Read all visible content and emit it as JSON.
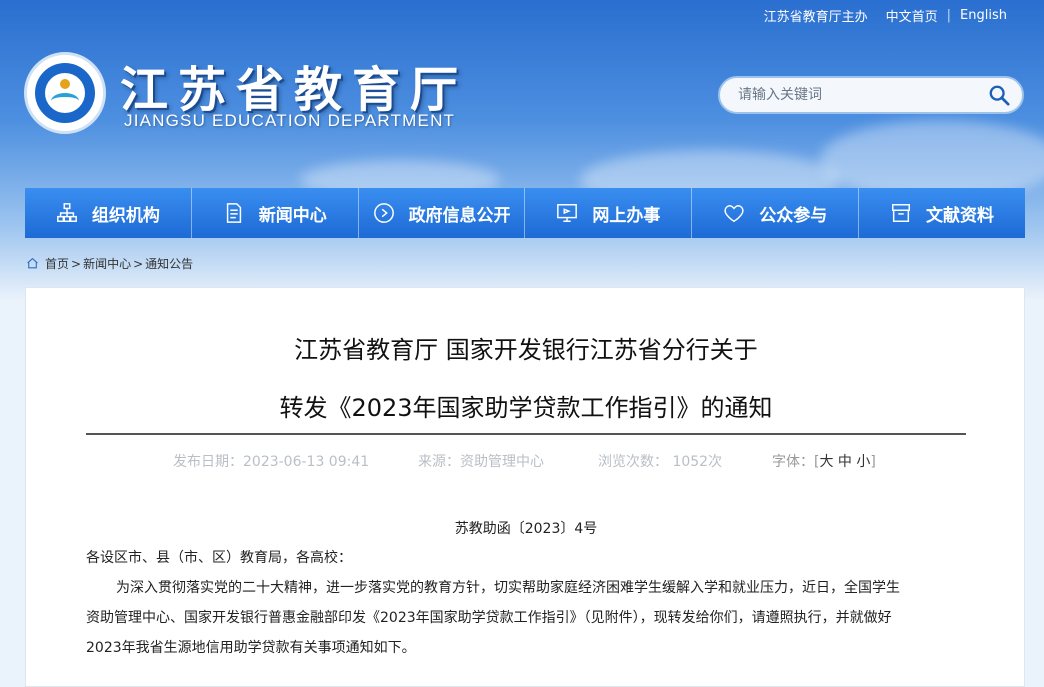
{
  "top_links": {
    "sponsor": "江苏省教育厅主办",
    "chinese": "中文首页",
    "divider": "|",
    "english": "English"
  },
  "site": {
    "title": "江苏省教育厅",
    "subtitle": "JIANGSU EDUCATION DEPARTMENT"
  },
  "search": {
    "placeholder": "请输入关键词",
    "icon": "search-icon"
  },
  "nav": {
    "items": [
      {
        "label": "组织机构",
        "icon": "org-chart-icon"
      },
      {
        "label": "新闻中心",
        "icon": "document-icon"
      },
      {
        "label": "政府信息公开",
        "icon": "play-circle-icon"
      },
      {
        "label": "网上办事",
        "icon": "monitor-icon"
      },
      {
        "label": "公众参与",
        "icon": "heart-icon"
      },
      {
        "label": "文献资料",
        "icon": "archive-icon"
      }
    ]
  },
  "breadcrumb": {
    "home": "首页",
    "sep1": ">",
    "news": "新闻中心",
    "sep2": ">",
    "current": "通知公告"
  },
  "article": {
    "title_line1": "江苏省教育厅 国家开发银行江苏省分行关于",
    "title_line2": "转发《2023年国家助学贷款工作指引》的通知",
    "meta": {
      "date": "发布日期：2023-06-13 09:41",
      "source": "来源：资助管理中心",
      "views": "浏览次数： 1052次",
      "font_label": "字体：[",
      "font_large": "大",
      "font_medium": "中",
      "font_small": "小",
      "font_close": "]"
    },
    "doc_number": "苏教助函〔2023〕4号",
    "salutation": "各设区市、县（市、区）教育局，各高校：",
    "para_line1": "为深入贯彻落实党的二十大精神，进一步落实党的教育方针，切实帮助家庭经济困难学生缓解入学和就业压力，近日，全国学生",
    "para_line2": "资助管理中心、国家开发银行普惠金融部印发《2023年国家助学贷款工作指引》（见附件），现转发给你们，请遵照执行，并就做好",
    "para_line3": "2023年我省生源地信用助学贷款有关事项通知如下。"
  }
}
